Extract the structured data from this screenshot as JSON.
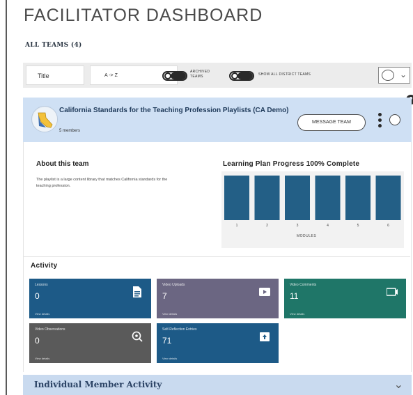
{
  "page": {
    "title": "FACILITATOR DASHBOARD",
    "all_teams_label": "ALL TEAMS (4)"
  },
  "toolbar": {
    "sort_field": "Title",
    "sort_direction": "A -> Z",
    "archived_label": "ARCHIVED TEAMS",
    "show_all_label": "SHOW ALL DISTRICT TEAMS"
  },
  "team": {
    "name": "California Standards for the Teaching Profession Playlists (CA Demo)",
    "members": "5 members",
    "message_button": "MESSAGE TEAM",
    "about_title": "About this team",
    "about_text": "The playlist is a large content library that matches California standards for the teaching profession.",
    "progress_title": "Learning Plan Progress 100% Complete",
    "progress_xlabel": "MODULES"
  },
  "chart_data": {
    "type": "bar",
    "categories": [
      "1",
      "2",
      "3",
      "4",
      "5",
      "6"
    ],
    "values": [
      100,
      100,
      100,
      100,
      100,
      100
    ],
    "xlabel": "MODULES",
    "ylim": [
      0,
      100
    ],
    "color": "#235f86"
  },
  "activity": {
    "title": "Activity",
    "tiles": [
      {
        "label": "Lessons",
        "value": "0",
        "link": "View details",
        "color": "#1d5a87",
        "icon": "document-icon"
      },
      {
        "label": "Video Uploads",
        "value": "7",
        "link": "View details",
        "color": "#6b6682",
        "icon": "video-camera-icon"
      },
      {
        "label": "Video Comments",
        "value": "11",
        "link": "View details",
        "color": "#1f7668",
        "icon": "comment-video-icon"
      },
      {
        "label": "Video Observations",
        "value": "0",
        "link": "View details",
        "color": "#5a5a5a",
        "icon": "magnify-icon"
      },
      {
        "label": "Self-Reflection Entries",
        "value": "71",
        "link": "View details",
        "color": "#1d5a87",
        "icon": "upload-icon"
      }
    ]
  },
  "individual": {
    "title": "Individual Member Activity"
  }
}
